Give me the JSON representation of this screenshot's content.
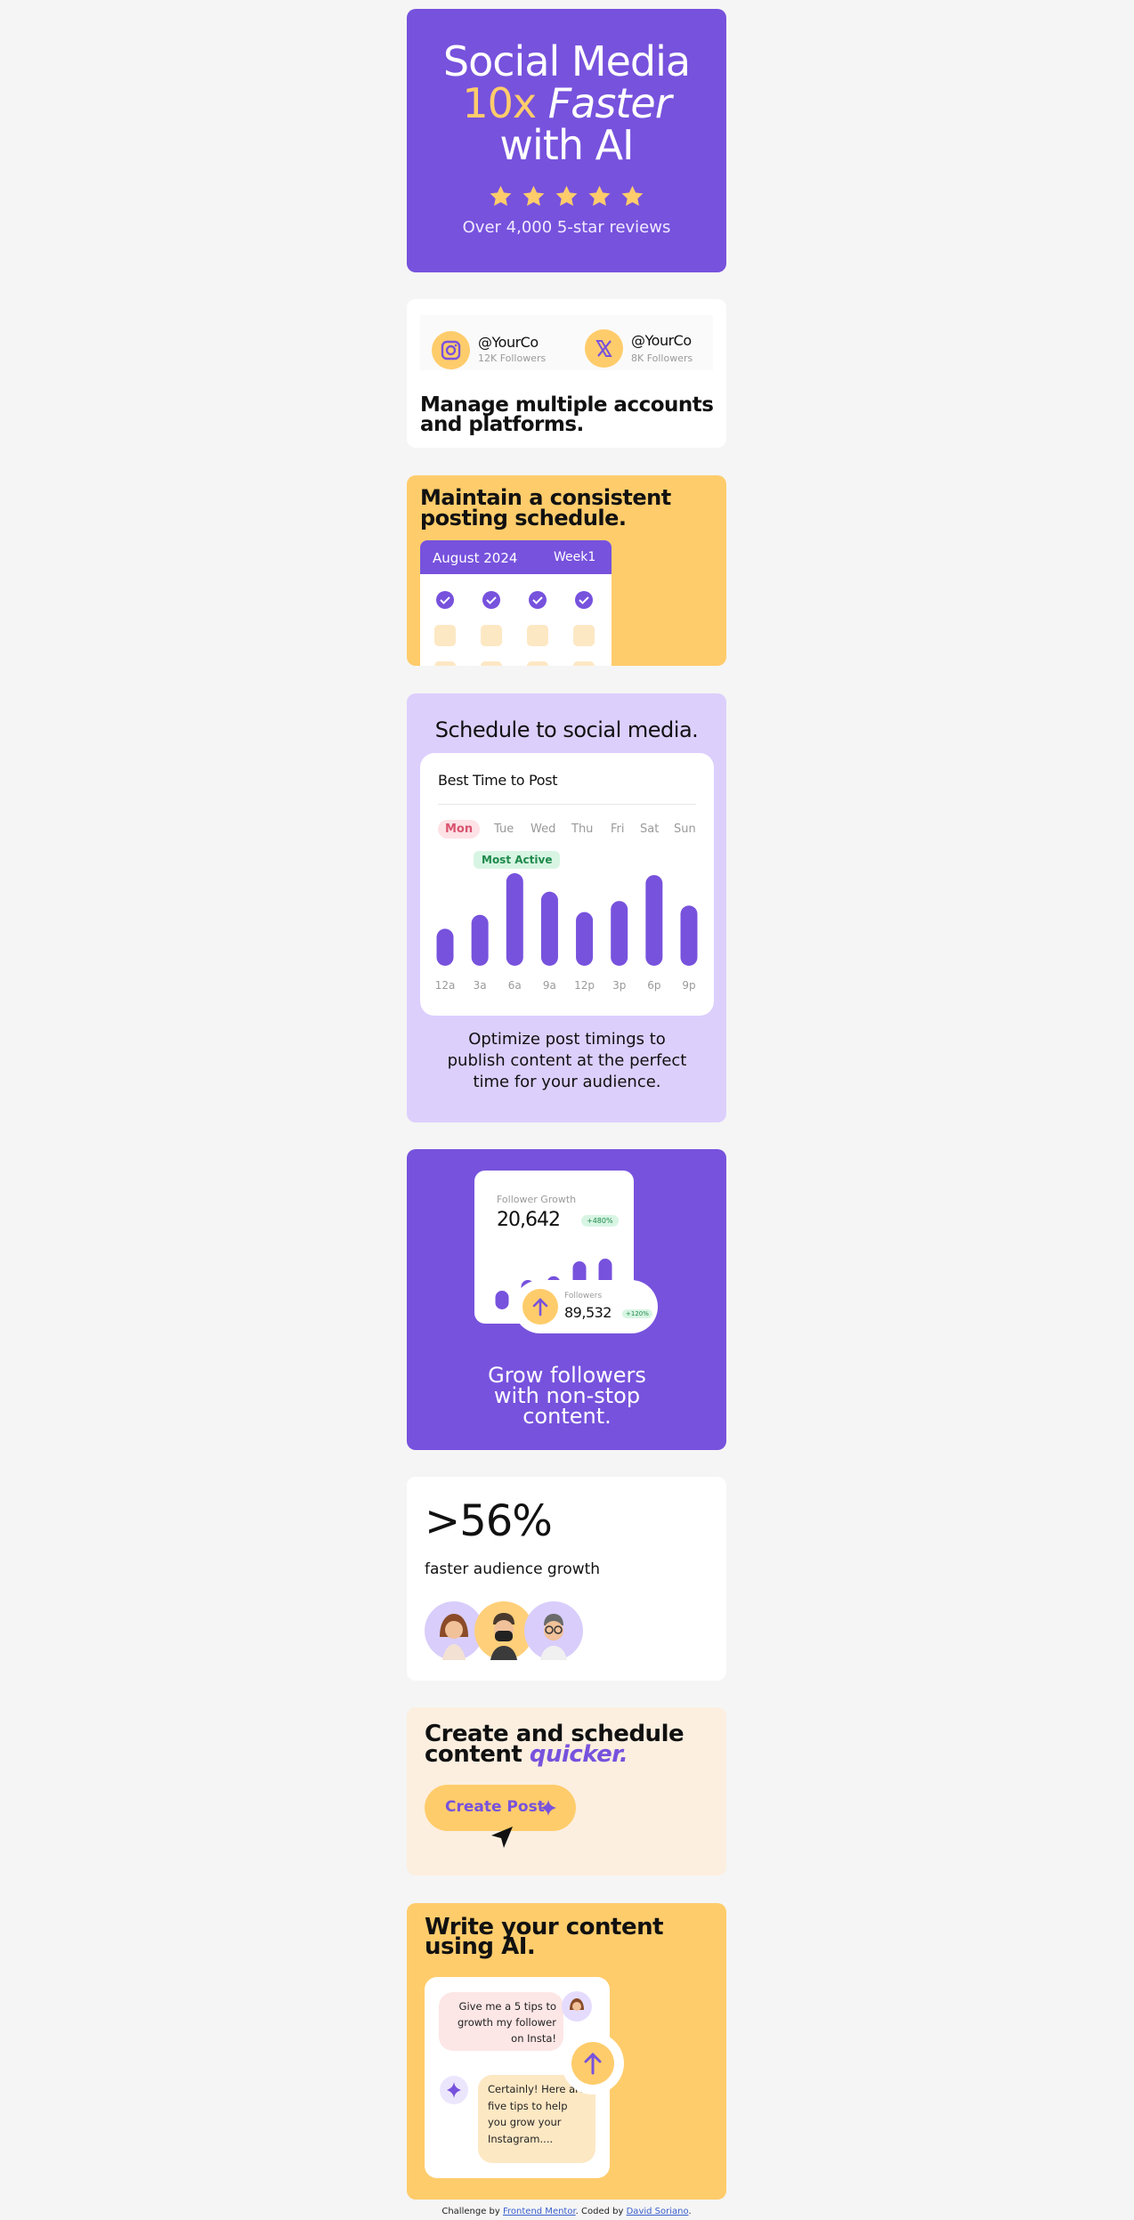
{
  "hero": {
    "line1": "Social Media",
    "accent": "10x",
    "italic": "Faster",
    "line3": "with AI",
    "stars": 5,
    "reviews": "Over 4,000 5-star reviews"
  },
  "accounts": {
    "items": [
      {
        "handle": "@YourCo",
        "followers": "12K Followers",
        "icon": "instagram-icon"
      },
      {
        "handle": "@YourCo",
        "followers": "8K Followers",
        "icon": "x-logo-icon"
      }
    ],
    "title": "Manage multiple accounts and platforms."
  },
  "schedule_card": {
    "title": "Maintain a consistent posting schedule.",
    "month": "August 2024",
    "week": "Week1"
  },
  "best_time": {
    "heading": "Schedule to social media.",
    "panel_title": "Best Time to Post",
    "days": [
      "Mon",
      "Tue",
      "Wed",
      "Thu",
      "Fri",
      "Sat",
      "Sun"
    ],
    "active_day": "Mon",
    "badge": "Most Active",
    "description": "Optimize post timings to publish content at the perfect time for your audience."
  },
  "chart_data": {
    "type": "bar",
    "categories": [
      "12a",
      "3a",
      "6a",
      "9a",
      "12p",
      "3p",
      "6p",
      "9p"
    ],
    "values": [
      40,
      55,
      100,
      80,
      58,
      70,
      98,
      65
    ],
    "title": "Best Time to Post",
    "xlabel": "",
    "ylabel": "",
    "ylim": [
      0,
      100
    ],
    "grid": false
  },
  "growth": {
    "label": "Follower Growth",
    "value": "20,642",
    "pct": "+480%",
    "bars": [
      35,
      55,
      62,
      90,
      95
    ],
    "followers_label": "Followers",
    "followers_value": "89,532",
    "followers_pct": "+120%",
    "title": "Grow followers with non-stop content."
  },
  "stat": {
    "value": ">56%",
    "label": "faster audience growth"
  },
  "create": {
    "title": "Create and schedule content",
    "title_em": "quicker.",
    "button": "Create Post"
  },
  "write": {
    "title": "Write your content using AI.",
    "user_msg": "Give me a 5 tips to growth my follower on Insta!",
    "ai_msg": "Certainly! Here are five tips to help you grow your Instagram...."
  },
  "footer": {
    "prefix": "Challenge by",
    "link1": "Frontend Mentor",
    "mid": ". Coded by",
    "link2": "David Soriano",
    "suffix": "."
  },
  "colors": {
    "purple": "#7752dd",
    "yellow": "#ffcc6b",
    "lilac": "#dccffc",
    "cream": "#fcefe0"
  }
}
